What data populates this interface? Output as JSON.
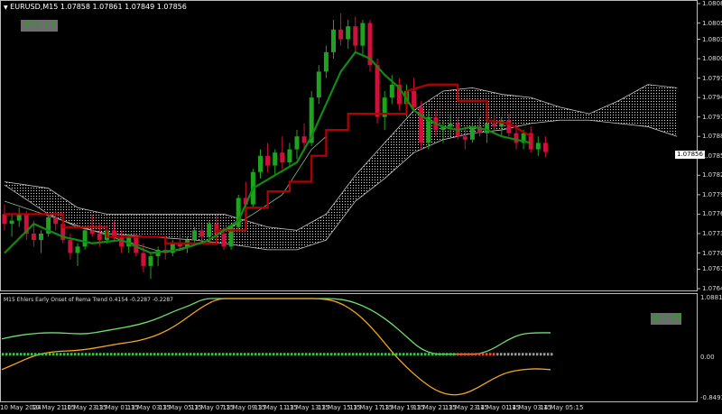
{
  "window": {
    "symbol_title": "EURUSD,M15",
    "ohlc": "1.07858 1.07861 1.07849 1.07856"
  },
  "buttons": {
    "ichi": "ICHI-off",
    "eot": "EOT-off"
  },
  "price_axis": [
    "1.08085",
    "1.08055",
    "1.08030",
    "1.08000",
    "1.07970",
    "1.07940",
    "1.07910",
    "1.07880",
    "1.07850",
    "1.07820",
    "1.07790",
    "1.07760",
    "1.07730",
    "1.07700",
    "1.07675",
    "1.07645"
  ],
  "current_price": "1.07856",
  "indicator": {
    "title": "M15 Ehlers Early Onset of Rema Trend 0.4154 -0.2287 -0.2287",
    "axis": [
      "1.0881",
      "0.00",
      "-0.8493"
    ]
  },
  "time_axis": [
    "10 May 2024",
    "10 May 21:15",
    "10 May 23:15",
    "13 May 01:15",
    "13 May 03:15",
    "13 May 05:15",
    "13 May 07:15",
    "13 May 09:15",
    "13 May 11:15",
    "13 May 13:15",
    "13 May 15:15",
    "13 May 17:15",
    "13 May 19:15",
    "13 May 21:15",
    "13 May 23:15",
    "14 May 01:15",
    "14 May 03:15",
    "14 May 05:15"
  ],
  "colors": {
    "bull": "#1fa21f",
    "bear": "#d0103a",
    "kijun": "#b30000",
    "tenkan": "#128a12",
    "cloud_edge": "#c8c8c8",
    "osc_upper": "#6fe06f",
    "osc_lower": "#f5a623",
    "dot_pos": "#2ecc40",
    "dot_neg": "#ff4422",
    "dot_neutral": "#999999"
  },
  "chart_data": [
    {
      "type": "candlestick",
      "title": "EURUSD,M15",
      "ylim": [
        1.07645,
        1.08085
      ],
      "candles": [
        [
          1.0776,
          1.07775,
          1.07735,
          1.07745
        ],
        [
          1.07745,
          1.0776,
          1.07725,
          1.0775
        ],
        [
          1.0775,
          1.0777,
          1.0774,
          1.0776
        ],
        [
          1.0776,
          1.07765,
          1.0772,
          1.0773
        ],
        [
          1.0773,
          1.0775,
          1.0771,
          1.0772
        ],
        [
          1.0772,
          1.07735,
          1.077,
          1.0773
        ],
        [
          1.0773,
          1.0776,
          1.07725,
          1.07755
        ],
        [
          1.07755,
          1.07765,
          1.07735,
          1.07745
        ],
        [
          1.07745,
          1.07755,
          1.07715,
          1.0772
        ],
        [
          1.0772,
          1.0773,
          1.0769,
          1.077
        ],
        [
          1.077,
          1.07715,
          1.0768,
          1.0771
        ],
        [
          1.0771,
          1.0774,
          1.07705,
          1.07735
        ],
        [
          1.07735,
          1.0776,
          1.07725,
          1.0773
        ],
        [
          1.0773,
          1.07745,
          1.0771,
          1.0772
        ],
        [
          1.0772,
          1.0774,
          1.07715,
          1.07735
        ],
        [
          1.07735,
          1.0775,
          1.0772,
          1.07725
        ],
        [
          1.07725,
          1.07735,
          1.077,
          1.0771
        ],
        [
          1.0771,
          1.0773,
          1.077,
          1.07725
        ],
        [
          1.07725,
          1.0773,
          1.07695,
          1.077
        ],
        [
          1.077,
          1.07715,
          1.0767,
          1.0768
        ],
        [
          1.0768,
          1.077,
          1.0766,
          1.07695
        ],
        [
          1.07695,
          1.0771,
          1.0768,
          1.07705
        ],
        [
          1.07705,
          1.0772,
          1.0769,
          1.077
        ],
        [
          1.077,
          1.0772,
          1.07695,
          1.07715
        ],
        [
          1.07715,
          1.0773,
          1.07705,
          1.0771
        ],
        [
          1.0771,
          1.07725,
          1.077,
          1.0772
        ],
        [
          1.0772,
          1.0774,
          1.07715,
          1.07735
        ],
        [
          1.07735,
          1.07745,
          1.0772,
          1.07725
        ],
        [
          1.07725,
          1.0775,
          1.0772,
          1.07745
        ],
        [
          1.07745,
          1.0776,
          1.07725,
          1.0773
        ],
        [
          1.0773,
          1.0774,
          1.07705,
          1.0771
        ],
        [
          1.0771,
          1.07745,
          1.07705,
          1.0774
        ],
        [
          1.0774,
          1.0779,
          1.07735,
          1.07785
        ],
        [
          1.07785,
          1.0781,
          1.0777,
          1.07775
        ],
        [
          1.07775,
          1.0783,
          1.0777,
          1.07825
        ],
        [
          1.07825,
          1.0786,
          1.07815,
          1.0785
        ],
        [
          1.0785,
          1.0787,
          1.07825,
          1.07835
        ],
        [
          1.07835,
          1.0786,
          1.0782,
          1.07855
        ],
        [
          1.07855,
          1.0788,
          1.0783,
          1.0784
        ],
        [
          1.0784,
          1.0787,
          1.07835,
          1.0786
        ],
        [
          1.0786,
          1.0789,
          1.07845,
          1.0788
        ],
        [
          1.0788,
          1.079,
          1.0786,
          1.0787
        ],
        [
          1.0787,
          1.0795,
          1.07865,
          1.0794
        ],
        [
          1.0794,
          1.0799,
          1.0793,
          1.0798
        ],
        [
          1.0798,
          1.0802,
          1.0797,
          1.0801
        ],
        [
          1.0801,
          1.0806,
          1.08,
          1.08045
        ],
        [
          1.08045,
          1.0807,
          1.0802,
          1.0803
        ],
        [
          1.0803,
          1.0806,
          1.08015,
          1.0805
        ],
        [
          1.0805,
          1.08065,
          1.0801,
          1.0802
        ],
        [
          1.0802,
          1.0806,
          1.08005,
          1.08055
        ],
        [
          1.08055,
          1.0806,
          1.0798,
          1.0799
        ],
        [
          1.0799,
          1.08,
          1.079,
          1.0791
        ],
        [
          1.0791,
          1.0795,
          1.0789,
          1.0794
        ],
        [
          1.0794,
          1.07975,
          1.0793,
          1.0796
        ],
        [
          1.0796,
          1.0797,
          1.0792,
          1.0793
        ],
        [
          1.0793,
          1.0796,
          1.0791,
          1.0795
        ],
        [
          1.0795,
          1.0797,
          1.0792,
          1.07925
        ],
        [
          1.07925,
          1.07935,
          1.0786,
          1.0787
        ],
        [
          1.0787,
          1.0792,
          1.0786,
          1.0791
        ],
        [
          1.0791,
          1.0792,
          1.0788,
          1.0789
        ],
        [
          1.0789,
          1.07905,
          1.0787,
          1.07895
        ],
        [
          1.07895,
          1.07915,
          1.0788,
          1.079
        ],
        [
          1.079,
          1.0791,
          1.07875,
          1.0788
        ],
        [
          1.0788,
          1.07895,
          1.0786,
          1.07875
        ],
        [
          1.07875,
          1.079,
          1.0787,
          1.07895
        ],
        [
          1.07895,
          1.0791,
          1.0788,
          1.07885
        ],
        [
          1.07885,
          1.07905,
          1.0787,
          1.079
        ],
        [
          1.079,
          1.07915,
          1.07885,
          1.07895
        ],
        [
          1.07895,
          1.0791,
          1.0788,
          1.07905
        ],
        [
          1.07905,
          1.07915,
          1.0788,
          1.07885
        ],
        [
          1.07885,
          1.079,
          1.0786,
          1.0787
        ],
        [
          1.0787,
          1.0789,
          1.0786,
          1.07885
        ],
        [
          1.07885,
          1.07895,
          1.07855,
          1.0786
        ],
        [
          1.0786,
          1.0788,
          1.0785,
          1.0787
        ],
        [
          1.0787,
          1.0788,
          1.07848,
          1.07856
        ]
      ],
      "kijun": [
        [
          0,
          1.0776
        ],
        [
          8,
          1.0776
        ],
        [
          8,
          1.0774
        ],
        [
          14,
          1.0774
        ],
        [
          14,
          1.07725
        ],
        [
          22,
          1.07725
        ],
        [
          22,
          1.07715
        ],
        [
          29,
          1.07715
        ],
        [
          29,
          1.07735
        ],
        [
          33,
          1.07735
        ],
        [
          33,
          1.0777
        ],
        [
          36,
          1.0777
        ],
        [
          36,
          1.07795
        ],
        [
          39,
          1.07795
        ],
        [
          39,
          1.0781
        ],
        [
          42,
          1.0781
        ],
        [
          42,
          1.0785
        ],
        [
          44,
          1.0785
        ],
        [
          44,
          1.0789
        ],
        [
          47,
          1.0789
        ],
        [
          47,
          1.07915
        ],
        [
          55,
          1.07915
        ],
        [
          55,
          1.0795
        ],
        [
          58,
          1.0796
        ],
        [
          62,
          1.0796
        ],
        [
          62,
          1.07935
        ],
        [
          66,
          1.07935
        ],
        [
          66,
          1.07905
        ],
        [
          69,
          1.079
        ],
        [
          72,
          1.0788
        ]
      ],
      "tenkan": [
        [
          0,
          1.077
        ],
        [
          4,
          1.07745
        ],
        [
          8,
          1.07725
        ],
        [
          12,
          1.07715
        ],
        [
          16,
          1.0772
        ],
        [
          20,
          1.077
        ],
        [
          24,
          1.07705
        ],
        [
          28,
          1.0772
        ],
        [
          32,
          1.0775
        ],
        [
          34,
          1.078
        ],
        [
          37,
          1.0782
        ],
        [
          40,
          1.0784
        ],
        [
          42,
          1.0788
        ],
        [
          44,
          1.0793
        ],
        [
          46,
          1.0798
        ],
        [
          48,
          1.0801
        ],
        [
          50,
          1.08
        ],
        [
          52,
          1.07975
        ],
        [
          54,
          1.07955
        ],
        [
          56,
          1.0792
        ],
        [
          58,
          1.07905
        ],
        [
          60,
          1.07895
        ],
        [
          62,
          1.0789
        ],
        [
          64,
          1.07895
        ],
        [
          66,
          1.0789
        ],
        [
          68,
          1.0788
        ],
        [
          70,
          1.07875
        ],
        [
          72,
          1.0787
        ]
      ],
      "cloud_upper": [
        [
          0,
          1.0781
        ],
        [
          6,
          1.078
        ],
        [
          10,
          1.0777
        ],
        [
          14,
          1.0776
        ],
        [
          20,
          1.0776
        ],
        [
          26,
          1.0776
        ],
        [
          30,
          1.0776
        ],
        [
          36,
          1.0774
        ],
        [
          40,
          1.07735
        ],
        [
          44,
          1.0776
        ],
        [
          48,
          1.0782
        ],
        [
          52,
          1.0787
        ],
        [
          56,
          1.0792
        ],
        [
          60,
          1.0795
        ],
        [
          64,
          1.07955
        ],
        [
          68,
          1.07945
        ],
        [
          72,
          1.0794
        ],
        [
          76,
          1.07925
        ],
        [
          80,
          1.07915
        ],
        [
          84,
          1.07935
        ],
        [
          88,
          1.0796
        ],
        [
          92,
          1.07955
        ]
      ],
      "cloud_lower": [
        [
          0,
          1.07805
        ],
        [
          6,
          1.0776
        ],
        [
          10,
          1.0774
        ],
        [
          14,
          1.0773
        ],
        [
          20,
          1.07725
        ],
        [
          26,
          1.0772
        ],
        [
          30,
          1.07715
        ],
        [
          36,
          1.07705
        ],
        [
          40,
          1.07705
        ],
        [
          44,
          1.0772
        ],
        [
          48,
          1.0778
        ],
        [
          52,
          1.07815
        ],
        [
          56,
          1.07855
        ],
        [
          60,
          1.07875
        ],
        [
          64,
          1.07885
        ],
        [
          68,
          1.0789
        ],
        [
          72,
          1.079
        ],
        [
          76,
          1.07905
        ],
        [
          80,
          1.07905
        ],
        [
          84,
          1.079
        ],
        [
          88,
          1.07895
        ],
        [
          92,
          1.0788
        ]
      ],
      "chikou": [
        [
          0,
          1.0778
        ],
        [
          8,
          1.0775
        ],
        [
          16,
          1.0772
        ],
        [
          22,
          1.077
        ],
        [
          28,
          1.0772
        ],
        [
          34,
          1.0776
        ],
        [
          38,
          1.0779
        ],
        [
          42,
          1.0786
        ],
        [
          44,
          1.0788
        ]
      ]
    },
    {
      "type": "line",
      "title": "M15 Ehlers Early Onset of Rema Trend 0.4154 -0.2287 -0.2287",
      "ylim": [
        -0.8493,
        1.0881
      ],
      "series": [
        {
          "values": [
            0.3,
            0.36,
            0.4,
            0.42,
            0.42,
            0.4,
            0.4,
            0.45,
            0.5,
            0.55,
            0.62,
            0.72,
            0.85,
            0.95,
            1.0881,
            1.0881,
            1.0881,
            1.0881,
            1.0881,
            1.0881,
            1.0881,
            1.0881,
            1.0881,
            1.0881,
            1.05,
            0.95,
            0.8,
            0.6,
            0.35,
            0.1,
            0.0,
            0.0,
            0.0,
            0.0,
            0.1,
            0.28,
            0.4,
            0.42,
            0.42
          ]
        },
        {
          "values": [
            -0.3,
            -0.18,
            -0.05,
            0.03,
            0.06,
            0.07,
            0.1,
            0.15,
            0.2,
            0.24,
            0.3,
            0.4,
            0.55,
            0.75,
            0.95,
            1.0881,
            1.0881,
            1.0881,
            1.0881,
            1.0881,
            1.0881,
            1.0881,
            1.0881,
            1.05,
            0.92,
            0.7,
            0.4,
            0.05,
            -0.25,
            -0.5,
            -0.7,
            -0.8,
            -0.78,
            -0.65,
            -0.48,
            -0.35,
            -0.3,
            -0.28,
            -0.3
          ]
        }
      ]
    }
  ]
}
